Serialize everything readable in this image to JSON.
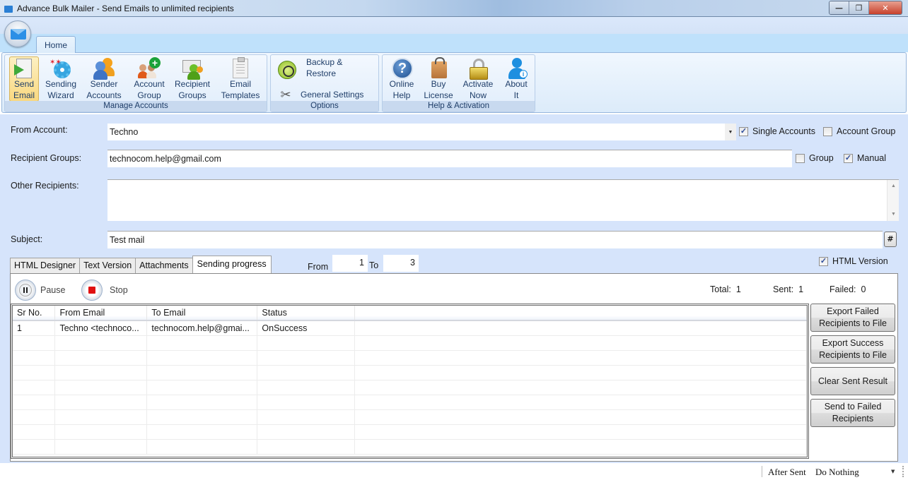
{
  "window": {
    "title": "Advance Bulk Mailer - Send Emails to unlimited recipients",
    "controls": {
      "minimize": "—",
      "restore": "❐",
      "close": "✕"
    }
  },
  "ribbon": {
    "tabs": [
      {
        "label": "Home",
        "active": true
      }
    ],
    "groups": [
      {
        "label": "Manage Accounts",
        "buttons": [
          {
            "label": "Send\nEmail",
            "icon": "send-email-icon",
            "active": true
          },
          {
            "label": "Sending\nWizard",
            "icon": "wizard-gear-icon"
          },
          {
            "label": "Sender\nAccounts",
            "icon": "sender-accounts-icon"
          },
          {
            "label": "Account\nGroup",
            "icon": "account-group-add-icon"
          },
          {
            "label": "Recipient\nGroups",
            "icon": "recipient-groups-icon"
          },
          {
            "label": "Email\nTemplates",
            "icon": "clipboard-template-icon"
          }
        ]
      },
      {
        "label": "Options",
        "buttons": [
          {
            "label": "Backup &\nRestore",
            "icon": "backup-clock-icon"
          },
          {
            "label": "General Settings",
            "icon": "tools-icon"
          }
        ]
      },
      {
        "label": "Help & Activation",
        "buttons": [
          {
            "label": "Online\nHelp",
            "icon": "help-icon"
          },
          {
            "label": "Buy\nLicense",
            "icon": "shopping-bag-icon"
          },
          {
            "label": "Activate\nNow",
            "icon": "padlock-icon"
          },
          {
            "label": "About\nIt",
            "icon": "user-info-icon"
          }
        ]
      }
    ]
  },
  "form": {
    "from_account": {
      "label": "From Account:",
      "value": "Techno"
    },
    "single_accounts": {
      "label": "Single Accounts",
      "checked": true
    },
    "account_group": {
      "label": "Account Group",
      "checked": false
    },
    "recipient_groups": {
      "label": "Recipient Groups:",
      "value": "technocom.help@gmail.com"
    },
    "group": {
      "label": "Group",
      "checked": false
    },
    "manual": {
      "label": "Manual",
      "checked": true
    },
    "other_recipients": {
      "label": "Other Recipients:",
      "value": ""
    },
    "subject": {
      "label": "Subject:",
      "value": "Test mail",
      "hash_button": "#"
    }
  },
  "tabs": {
    "items": [
      {
        "label": "HTML Designer",
        "active": false
      },
      {
        "label": "Text Version",
        "active": false
      },
      {
        "label": "Attachments",
        "active": false
      },
      {
        "label": "Sending progress",
        "active": true
      }
    ],
    "range": {
      "from_label": "From",
      "from_value": "1",
      "to_label": "To",
      "to_value": "3"
    },
    "html_version": {
      "label": "HTML Version",
      "checked": true
    }
  },
  "progress": {
    "pause_label": "Pause",
    "stop_label": "Stop",
    "total_label": "Total:",
    "total_value": "1",
    "sent_label": "Sent:",
    "sent_value": "1",
    "failed_label": "Failed:",
    "failed_value": "0",
    "columns": [
      "Sr No.",
      "From Email",
      "To Email",
      "Status",
      ""
    ],
    "rows": [
      [
        "1",
        "Techno <technoco...",
        "technocom.help@gmai...",
        "OnSuccess",
        ""
      ]
    ],
    "side_buttons": [
      "Export Failed\nRecipients to File",
      "Export Success\nRecipients to File",
      "Clear Sent Result",
      "Send to Failed\nRecipients"
    ]
  },
  "statusbar": {
    "after_sent_label": "After Sent",
    "after_sent_value": "Do Nothing"
  },
  "colors": {
    "ribbon_label": "#1e3d68",
    "main_bg": "#d6e4fb",
    "active_button": "#f9d880",
    "stop_red": "#e01010"
  }
}
